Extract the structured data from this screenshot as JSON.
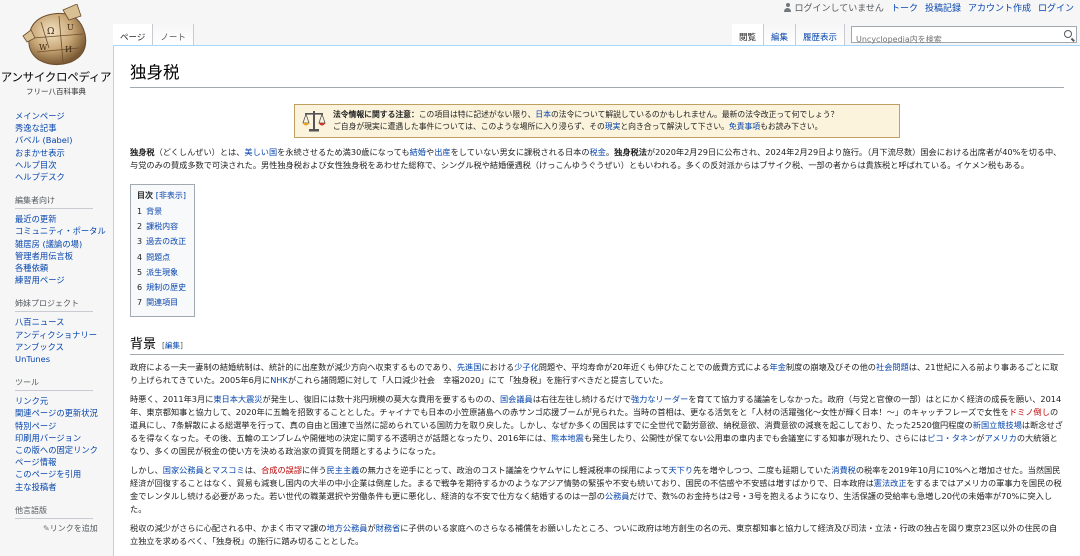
{
  "personal": {
    "not_logged_in": "ログインしていません",
    "talk": "トーク",
    "contributions": "投稿記録",
    "create_account": "アカウント作成",
    "login": "ログイン"
  },
  "logo": {
    "title": "アンサイクロペディア",
    "tagline": "フリー八百科事典",
    "alt": "Uncyclopedia logo"
  },
  "sidebar": {
    "nav": [
      "メインページ",
      "秀逸な記事",
      "バベル (Babel)",
      "おまかせ表示",
      "ヘルプ目次",
      "ヘルプデスク"
    ],
    "edit_heading": "編集者向け",
    "edit": [
      "最近の更新",
      "コミュニティ・ポータル",
      "雑居房 (議論の場)",
      "管理者用伝言板",
      "各種依頼",
      "練習用ページ"
    ],
    "sister_heading": "姉妹プロジェクト",
    "sister": [
      "八百ニュース",
      "アンディクショナリー",
      "アンブックス",
      "UnTunes"
    ],
    "tools_heading": "ツール",
    "tools": [
      "リンク元",
      "関連ページの更新状況",
      "特別ページ",
      "印刷用バージョン",
      "この版への固定リンク",
      "ページ情報",
      "このページを引用",
      "主な投稿者"
    ],
    "other_lang_heading": "他言語版",
    "add_link": "リンクを追加"
  },
  "tabs": {
    "page": "ページ",
    "talk": "ノート",
    "read": "閲覧",
    "edit": "編集",
    "history": "履歴表示"
  },
  "search": {
    "placeholder": "Uncyclopedia内を検索"
  },
  "article": {
    "title": "独身税",
    "notice": {
      "label": "法令情報に関する注意：",
      "t1": "この項目は特に記述がない限り、",
      "l1": "日本",
      "t2": "の法令について解説しているのかもしれません。最新の法令改正って何でしょう？",
      "t3": "ご自身が現実に遭遇した事件については、このような場所に入り浸らず、その",
      "l2": "現実",
      "t4": "と向き合って解決して下さい。",
      "l3": "免責事項",
      "t5": "もお読み下さい。"
    },
    "lead": {
      "term": "独身税",
      "t1": "（どくしんぜい）とは、",
      "l1": "美しい国",
      "t2": "を永続させるため満30歳になっても",
      "l2": "結婚",
      "t3": "や",
      "l3": "出産",
      "t4": "をしていない男女に課税される日本の",
      "l4": "税金",
      "t5": "。",
      "b2": "独身税法",
      "t6": "が2020年2月29日に公布され、2024年2月29日より施行。（月下流尽数）国会における出席者が40%を切る中、与党のみの賛成多数で可決された。男性独身税および女性独身税をあわせた総称で、シングル税や結婚優遇税（けっこんゆうぐうぜい）ともいわれる。多くの反対派からはブサイク税、一部の者からは貴族税と呼ばれている。イケメン税もある。"
    },
    "toc": {
      "title": "目次",
      "toggle": "[非表示]",
      "items": [
        {
          "num": "1",
          "text": "背景"
        },
        {
          "num": "2",
          "text": "課税内容"
        },
        {
          "num": "3",
          "text": "過去の改正"
        },
        {
          "num": "4",
          "text": "問題点"
        },
        {
          "num": "5",
          "text": "派生現象"
        },
        {
          "num": "6",
          "text": "規制の歴史"
        },
        {
          "num": "7",
          "text": "関連項目"
        }
      ]
    },
    "section1": {
      "title": "背景",
      "edit": "[編集]"
    },
    "p1": {
      "t1": "政府による一夫一妻制の結婚統制は、統計的に出産数が減少方向へ収束するものであり、",
      "l1": "先進国",
      "t2": "における",
      "l2": "少子化",
      "t3": "問題や、平均寿命が20年近くも伸びたことでの歳費方式による",
      "l3": "年金",
      "t4": "制度の崩壊及びその他の",
      "l4": "社会問題",
      "t5": "は、21世紀に入る前より事あるごとに取り上げられてきていた。2005年6月に",
      "l5": "NHK",
      "t6": "がこれら諸問題に対して「人口減少社会　幸福2020」にて「独身税」を施行すべきだと提言していた。"
    },
    "p2": {
      "t1": "時悪く、2011年3月に",
      "l1": "東日本大震災",
      "t2": "が発生し、復旧には数十兆円規模の莫大な費用を要するものの、",
      "l2": "国会議員",
      "t3": "は右往左往し続けるだけで",
      "l3": "強力なリーダー",
      "t4": "を育てて協力する議論をしなかった。政府（与党と官僚の一部）はとにかく経済の成長を願い、2014年、東京都知事と協力して、2020年に五輪を招致することとした。チャイナでも日本の小笠原諸島への赤サンゴ応援ブームが見られた。当時の首相は、更なる活気をと「人材の活躍強化〜女性が輝く日本！〜」のキャッチフレーズで女性を",
      "l4": "ドミノ倒し",
      "t5": "の道具にし、7条解散による総選挙を行って、真の自由と国連で当然に認められている国防力を取り戻した。しかし、なぜか多くの国民はすでに全世代で勤労意欲、納税意欲、消費意欲の減衰を起こしており、たった2520億円程度の",
      "l5": "新国立競技場",
      "t6": "は断念せざるを得なくなった。その後、五輪のエンブレムや開催地の決定に関する不透明さが話題となったり、2016年には、",
      "l6": "熊本地震",
      "t7": "も発生したり、公開性が保てない公用車の車内までも会議室にする知事が現れたり、さらには",
      "l7": "ピコ・タネン",
      "t8": "が",
      "l8": "アメリカ",
      "t9": "の大統領となり、多くの国民が税金の使い方を決める政治家の資質を問題とするようになった。"
    },
    "p3": {
      "t1": "しかし、",
      "l1": "国家公務員",
      "t2": "と",
      "l2": "マスコミ",
      "t3": "は、",
      "l3": "合成の誤謬",
      "t4": "に伴う",
      "l4": "民主主義",
      "t5": "の無力さを逆手にとって、政治のコスト議論をウヤムヤにし軽減税率の採用によって",
      "l5": "天下り",
      "t6": "先を増やしつつ、二度も延期していた",
      "l6": "消費税",
      "t7": "の税率を2019年10月に10%へと増加させた。当然国民経済が回復することはなく、貿易も減衰し国内の大半の中小企業は倒産した。まるで戦争を期待するかのようなアジア情勢の緊張や不安も続いており、国民の不信感や不安感は増すばかりで、日本政府は",
      "l7": "憲法改正",
      "t8": "をするまではアメリカの軍事力を国民の税金でレンタルし続ける必要があった。若い世代の職業選択や労働条件も更に悪化し、経済的な不安で仕方なく結婚するのは一部の",
      "l8": "公務員",
      "t9": "だけで、数%のお金持ちは2号・3号を抱えるようになり、生活保護の受給率も急増し20代の未婚率が70%に突入した。"
    },
    "p4": {
      "t1": "税収の減少がさらに心配される中、かまく市ママ課の",
      "l1": "地方公務員",
      "t2": "が",
      "l2": "財務省",
      "t3": "に子供のいる家庭へのさらなる補償をお願いしたところ、ついに政府は地方創生の名の元、東京都知事と協力して経済及び司法・立法・行政の独占を図り東京23区以外の住民の自立独立を求めるべく、「独身税」の施行に踏み切ることとした。"
    }
  }
}
